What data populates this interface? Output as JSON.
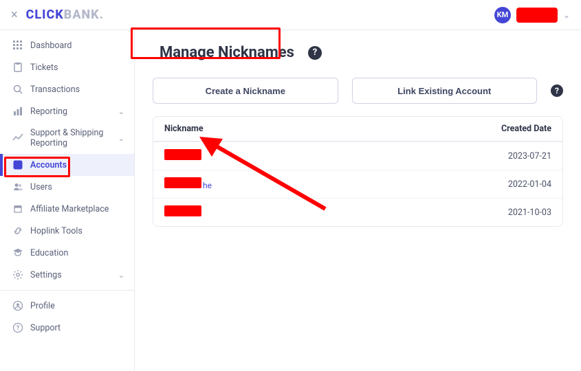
{
  "brand": {
    "click": "CLICK",
    "bank": "BANK",
    "dot": "."
  },
  "header": {
    "close_label": "×",
    "avatar_initials": "KM",
    "user_chevron": "⌄"
  },
  "sidebar": {
    "items": [
      {
        "label": "Dashboard"
      },
      {
        "label": "Tickets"
      },
      {
        "label": "Transactions"
      },
      {
        "label": "Reporting"
      },
      {
        "label": "Support & Shipping Reporting"
      },
      {
        "label": "Accounts"
      },
      {
        "label": "Users"
      },
      {
        "label": "Affiliate Marketplace"
      },
      {
        "label": "Hoplink Tools"
      },
      {
        "label": "Education"
      },
      {
        "label": "Settings"
      },
      {
        "label": "Profile"
      },
      {
        "label": "Support"
      }
    ]
  },
  "page": {
    "title": "Manage Nicknames",
    "help_glyph": "?",
    "create_btn": "Create a Nickname",
    "link_btn": "Link Existing Account"
  },
  "table": {
    "col_name": "Nickname",
    "col_date": "Created Date",
    "rows": [
      {
        "link_suffix": "",
        "date": "2023-07-21"
      },
      {
        "link_suffix": "he",
        "date": "2022-01-04"
      },
      {
        "link_suffix": "",
        "date": "2021-10-03"
      }
    ]
  }
}
